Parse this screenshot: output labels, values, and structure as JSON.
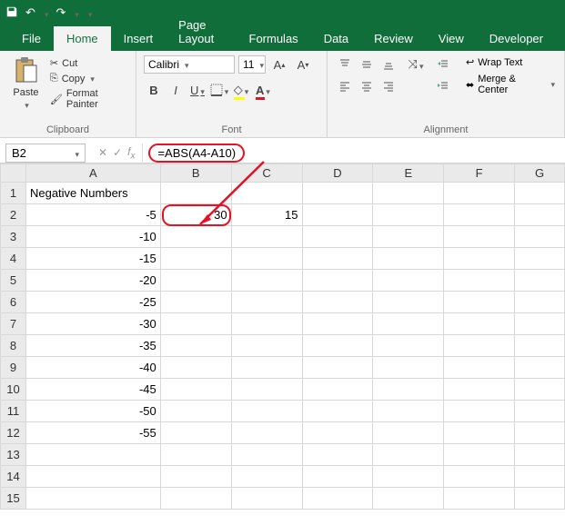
{
  "titlebar": {
    "save": "💾",
    "undo": "↶",
    "redo": "↷"
  },
  "tabs": {
    "file": "File",
    "home": "Home",
    "insert": "Insert",
    "pageLayout": "Page Layout",
    "formulas": "Formulas",
    "data": "Data",
    "review": "Review",
    "view": "View",
    "developer": "Developer"
  },
  "ribbon": {
    "clipboard": {
      "paste": "Paste",
      "cut": "Cut",
      "copy": "Copy",
      "formatPainter": "Format Painter",
      "groupLabel": "Clipboard"
    },
    "font": {
      "name": "Calibri",
      "size": "11",
      "groupLabel": "Font",
      "bold": "B",
      "italic": "I",
      "underline": "U"
    },
    "alignment": {
      "wrapText": "Wrap Text",
      "mergeCenter": "Merge & Center",
      "groupLabel": "Alignment"
    }
  },
  "formulaBar": {
    "nameBox": "B2",
    "formula": "=ABS(A4-A10)"
  },
  "sheet": {
    "columns": [
      "A",
      "B",
      "C",
      "D",
      "E",
      "F",
      "G"
    ],
    "rows": [
      {
        "n": "1",
        "A": "Negative Numbers",
        "B": "",
        "C": ""
      },
      {
        "n": "2",
        "A": "-5",
        "B": "30",
        "C": "15"
      },
      {
        "n": "3",
        "A": "-10",
        "B": "",
        "C": ""
      },
      {
        "n": "4",
        "A": "-15",
        "B": "",
        "C": ""
      },
      {
        "n": "5",
        "A": "-20",
        "B": "",
        "C": ""
      },
      {
        "n": "6",
        "A": "-25",
        "B": "",
        "C": ""
      },
      {
        "n": "7",
        "A": "-30",
        "B": "",
        "C": ""
      },
      {
        "n": "8",
        "A": "-35",
        "B": "",
        "C": ""
      },
      {
        "n": "9",
        "A": "-40",
        "B": "",
        "C": ""
      },
      {
        "n": "10",
        "A": "-45",
        "B": "",
        "C": ""
      },
      {
        "n": "11",
        "A": "-50",
        "B": "",
        "C": ""
      },
      {
        "n": "12",
        "A": "-55",
        "B": "",
        "C": ""
      },
      {
        "n": "13",
        "A": "",
        "B": "",
        "C": ""
      },
      {
        "n": "14",
        "A": "",
        "B": "",
        "C": ""
      },
      {
        "n": "15",
        "A": "",
        "B": "",
        "C": ""
      }
    ]
  }
}
